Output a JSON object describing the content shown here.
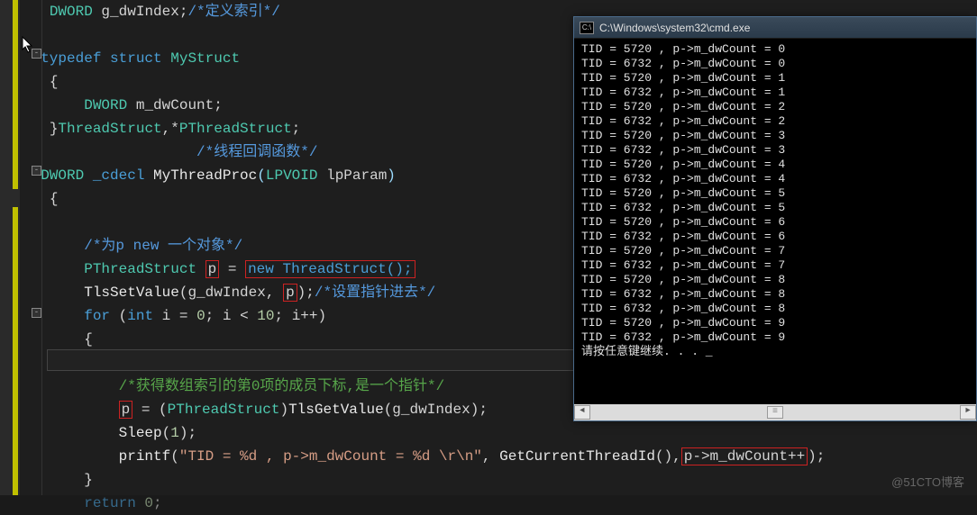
{
  "editor": {
    "lines": {
      "l1a": "DWORD",
      "l1b": " g_dwIndex;",
      "l1c": "/*定义索引*/",
      "l2a": "typedef",
      "l2b": " struct",
      "l2c": " MyStruct",
      "l3": "{",
      "l4a": "DWORD",
      "l4b": " m_dwCount;",
      "l5a": "}",
      "l5b": "ThreadStruct",
      "l5c": ",*",
      "l5d": "PThreadStruct",
      "l5e": ";",
      "l6": "/*线程回调函数*/",
      "l7a": "DWORD",
      "l7b": " _cdecl",
      "l7c": " MyThreadProc",
      "l7d": "(",
      "l7e": "LPVOID",
      "l7f": " lpParam",
      "l7g": ")",
      "l8": "{",
      "l9": "/*为p new 一个对象*/",
      "l10a": "PThreadStruct",
      "l10b": "p",
      "l10c": " = ",
      "l10d": "new ThreadStruct();",
      "l11a": "TlsSetValue",
      "l11b": "(g_dwIndex, ",
      "l11c": "p",
      "l11d": ");",
      "l11e": "/*设置指针进去*/",
      "l12a": "for",
      "l12b": " (",
      "l12c": "int",
      "l12d": " i = ",
      "l12e": "0",
      "l12f": "; i < ",
      "l12g": "10",
      "l12h": "; i++)",
      "l13": "{",
      "l14": "/*获得数组索引的第0项的成员下标,是一个指针*/",
      "l15a": "p",
      "l15b": " = (",
      "l15c": "PThreadStruct",
      "l15d": ")",
      "l15e": "TlsGetValue",
      "l15f": "(g_dwIndex);",
      "l16a": "Sleep",
      "l16b": "(",
      "l16c": "1",
      "l16d": ");",
      "l17a": "printf",
      "l17b": "(",
      "l17c": "\"TID = %d , p->m_dwCount = %d \\r\\n\"",
      "l17d": ", ",
      "l17e": "GetCurrentThreadId",
      "l17f": "(),",
      "l17g": "p->m_dwCount++",
      "l17h": ");",
      "l18": "}",
      "l19a": "return",
      "l19b": " 0",
      "l19c": ";"
    }
  },
  "cmd": {
    "title": "C:\\Windows\\system32\\cmd.exe",
    "output": [
      {
        "tid": 5720,
        "count": 0
      },
      {
        "tid": 6732,
        "count": 0
      },
      {
        "tid": 5720,
        "count": 1
      },
      {
        "tid": 6732,
        "count": 1
      },
      {
        "tid": 5720,
        "count": 2
      },
      {
        "tid": 6732,
        "count": 2
      },
      {
        "tid": 5720,
        "count": 3
      },
      {
        "tid": 6732,
        "count": 3
      },
      {
        "tid": 5720,
        "count": 4
      },
      {
        "tid": 6732,
        "count": 4
      },
      {
        "tid": 5720,
        "count": 5
      },
      {
        "tid": 6732,
        "count": 5
      },
      {
        "tid": 5720,
        "count": 6
      },
      {
        "tid": 6732,
        "count": 6
      },
      {
        "tid": 5720,
        "count": 7
      },
      {
        "tid": 6732,
        "count": 7
      },
      {
        "tid": 5720,
        "count": 8
      },
      {
        "tid": 6732,
        "count": 8
      },
      {
        "tid": 6732,
        "count": 8
      },
      {
        "tid": 5720,
        "count": 9
      },
      {
        "tid": 6732,
        "count": 9
      }
    ],
    "prompt": "请按任意键继续. . . _",
    "icon_text": "C:\\"
  },
  "watermark": "@51CTO博客"
}
